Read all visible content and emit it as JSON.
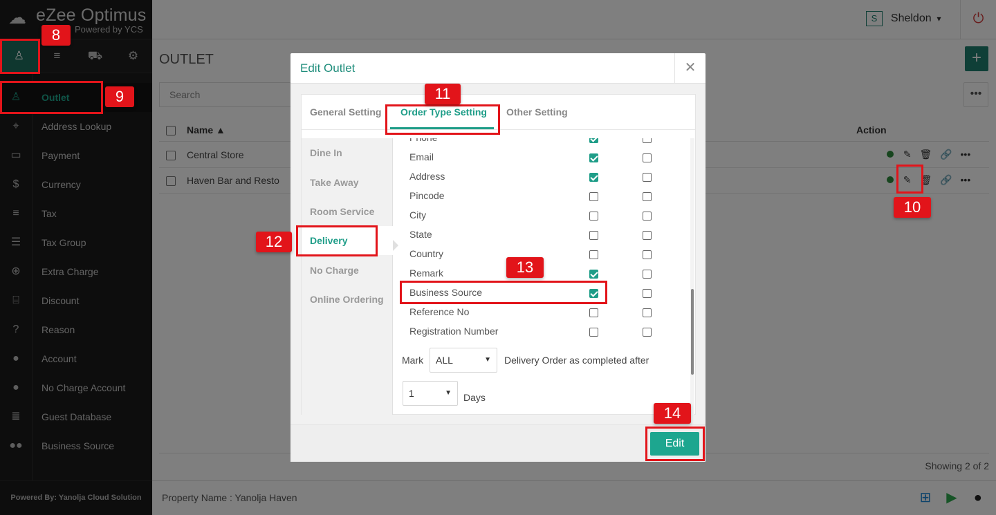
{
  "brand": {
    "logo_name": "eZee Optimus",
    "logo_by": "Powered by YCS"
  },
  "sidebar": {
    "icon_tabs": [
      {
        "name": "user-icon",
        "glyph": "♙"
      },
      {
        "name": "list-icon",
        "glyph": "≡"
      },
      {
        "name": "cart-icon",
        "glyph": "⛟"
      },
      {
        "name": "gear-icon",
        "glyph": "⚙"
      }
    ],
    "items": [
      {
        "label": "Outlet",
        "icon": "user-icon",
        "glyph": "♙"
      },
      {
        "label": "Address Lookup",
        "icon": "map-pin-icon",
        "glyph": "⌖"
      },
      {
        "label": "Payment",
        "icon": "credit-card-icon",
        "glyph": "▭"
      },
      {
        "label": "Currency",
        "icon": "dollar-icon",
        "glyph": "$"
      },
      {
        "label": "Tax",
        "icon": "bars-icon",
        "glyph": "≡"
      },
      {
        "label": "Tax Group",
        "icon": "list-icon",
        "glyph": "☰"
      },
      {
        "label": "Extra Charge",
        "icon": "plus-circle-icon",
        "glyph": "⊕"
      },
      {
        "label": "Discount",
        "icon": "gift-icon",
        "glyph": "⌸"
      },
      {
        "label": "Reason",
        "icon": "question-circle-icon",
        "glyph": "?"
      },
      {
        "label": "Account",
        "icon": "person-icon",
        "glyph": "●"
      },
      {
        "label": "No Charge Account",
        "icon": "person-icon",
        "glyph": "●"
      },
      {
        "label": "Guest Database",
        "icon": "database-icon",
        "glyph": "≣"
      },
      {
        "label": "Business Source",
        "icon": "users-icon",
        "glyph": "●●"
      }
    ],
    "footer": "Powered By: Yanolja Cloud Solution"
  },
  "header": {
    "user_initial": "S",
    "user_name": "Sheldon",
    "user_caret": "▾",
    "power_glyph": "⏻"
  },
  "main": {
    "title": "OUTLET",
    "add_glyph": "+",
    "more_glyph": "•••",
    "search_placeholder": "Search",
    "columns": {
      "name": "Name ▲",
      "action": "Action"
    },
    "rows": [
      {
        "name": "Central Store"
      },
      {
        "name": "Haven Bar and Resto"
      }
    ],
    "action_glyphs": {
      "edit": "✎",
      "delete": "🗑",
      "link": "🔗",
      "more": "•••"
    },
    "showing": "Showing 2 of 2"
  },
  "footer": {
    "property": "Property Name : Yanolja Haven"
  },
  "modal": {
    "title": "Edit Outlet",
    "close_glyph": "✕",
    "tabs": [
      "General Setting",
      "Order Type Setting",
      "Other Setting"
    ],
    "subnav": [
      "Dine In",
      "Take Away",
      "Room Service",
      "Delivery",
      "No Charge",
      "Online Ordering"
    ],
    "fields": [
      {
        "label": "Phone",
        "c1": true,
        "c2": false
      },
      {
        "label": "Email",
        "c1": true,
        "c2": false
      },
      {
        "label": "Address",
        "c1": true,
        "c2": false
      },
      {
        "label": "Pincode",
        "c1": false,
        "c2": false
      },
      {
        "label": "City",
        "c1": false,
        "c2": false
      },
      {
        "label": "State",
        "c1": false,
        "c2": false
      },
      {
        "label": "Country",
        "c1": false,
        "c2": false
      },
      {
        "label": "Remark",
        "c1": true,
        "c2": false
      },
      {
        "label": "Business Source",
        "c1": true,
        "c2": false
      },
      {
        "label": "Reference No",
        "c1": false,
        "c2": false
      },
      {
        "label": "Registration Number",
        "c1": false,
        "c2": false
      }
    ],
    "mark_label": "Mark",
    "mark_value": "ALL",
    "mark_after": "Delivery Order as completed after",
    "days_value": "1",
    "days_label": "Days",
    "caret": "▼",
    "edit_button": "Edit"
  },
  "annotations": [
    "8",
    "9",
    "10",
    "11",
    "12",
    "13",
    "14"
  ],
  "colors": {
    "accent": "#1e9d88",
    "sidebar_bg": "#1b1b1b",
    "highlight": "#e2141a"
  }
}
